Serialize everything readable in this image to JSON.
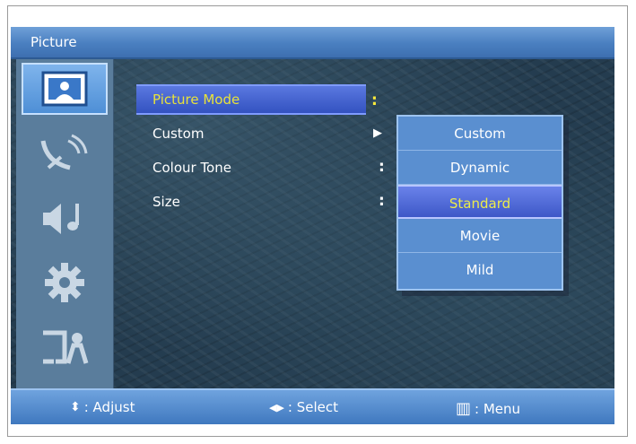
{
  "header": {
    "title": "Picture"
  },
  "sidebar": {
    "items": [
      {
        "icon": "picture-icon",
        "selected": true
      },
      {
        "icon": "satellite-dish-icon",
        "selected": false
      },
      {
        "icon": "sound-icon",
        "selected": false
      },
      {
        "icon": "gear-icon",
        "selected": false
      },
      {
        "icon": "input-icon",
        "selected": false
      }
    ]
  },
  "menu": {
    "items": [
      {
        "label": "Picture Mode",
        "marker": ":"
      },
      {
        "label": "Custom",
        "marker": "▶"
      },
      {
        "label": "Colour Tone",
        "marker": ":"
      },
      {
        "label": "Size",
        "marker": ":"
      }
    ]
  },
  "popup": {
    "options": [
      "Custom",
      "Dynamic",
      "Standard",
      "Movie",
      "Mild"
    ],
    "selected": "Standard"
  },
  "footer": {
    "adjust": {
      "glyph": "⬍",
      "label": ": Adjust"
    },
    "select": {
      "glyph": "◀▶",
      "label": ": Select"
    },
    "menu": {
      "glyph": "▥",
      "label": ": Menu"
    }
  },
  "colors": {
    "highlight_text": "#e8e23a",
    "title_bar": "#4a7fc0",
    "popup_bg": "#5a8fd0"
  }
}
